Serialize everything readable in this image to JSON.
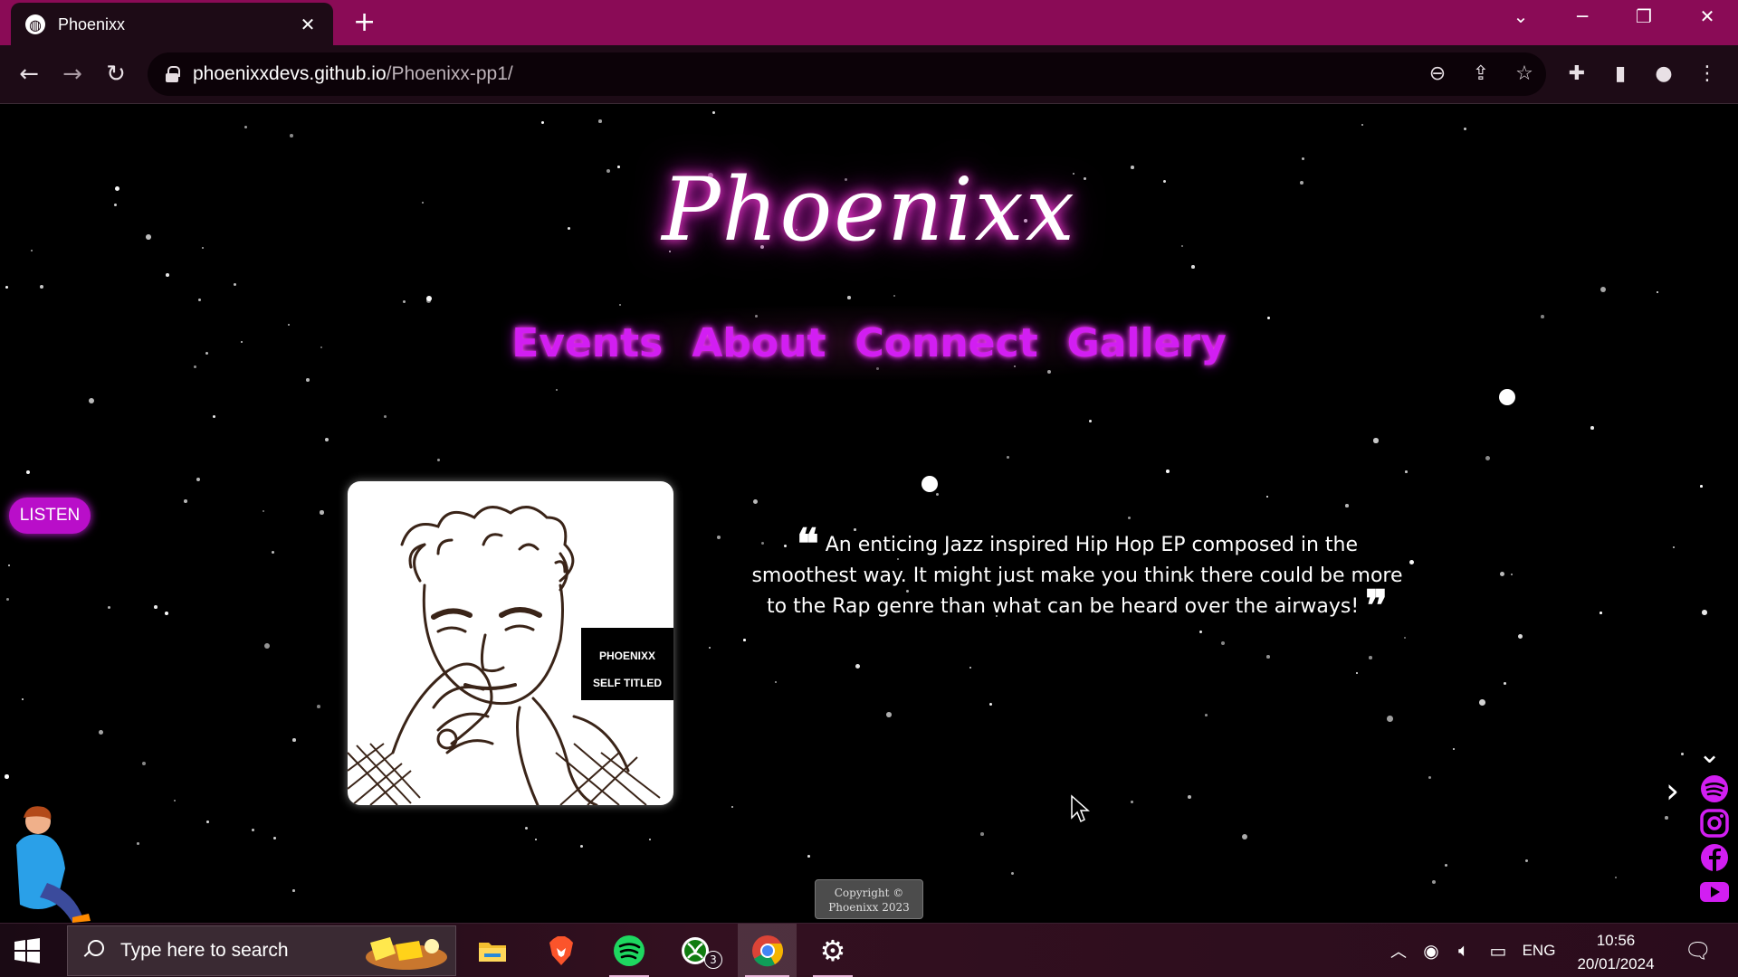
{
  "browser": {
    "tab_title": "Phoenixx",
    "tab_close": "✕",
    "new_tab": "+",
    "url_host": "phoenixxdevs.github.io",
    "url_path": "/Phoenixx-pp1/",
    "accent_color": "#8a0b56"
  },
  "site": {
    "logo": "Phoenixx",
    "nav": [
      "Events",
      "About",
      "Connect",
      "Gallery"
    ],
    "listen_label": "LISTEN",
    "album_line1": "PHOENIXX",
    "album_line2": "SELF TITLED",
    "quote_open": "❝",
    "quote_text": "An enticing Jazz inspired Hip Hop EP composed in the smoothest way. It might just make you think there could be more to the Rap genre than what can be heard over the airways!",
    "quote_close": "❞",
    "copyright_line1": "Copyright ©",
    "copyright_line2": "Phoenixx 2023",
    "nav_color": "#d21ef2",
    "social_icons": [
      "spotify-icon",
      "instagram-icon",
      "facebook-icon",
      "youtube-icon"
    ]
  },
  "taskbar": {
    "search_placeholder": "Type here to search",
    "xbox_badge": "3",
    "language": "ENG",
    "time": "10:56",
    "date": "20/01/2024"
  }
}
